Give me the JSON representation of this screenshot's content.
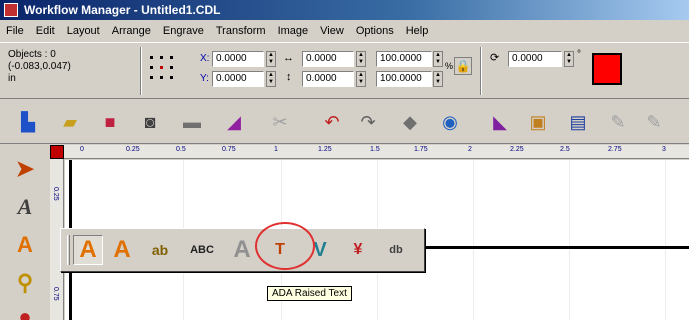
{
  "window": {
    "title": "Workflow Manager - Untitled1.CDL"
  },
  "menu": [
    "File",
    "Edit",
    "Layout",
    "Arrange",
    "Engrave",
    "Transform",
    "Image",
    "View",
    "Options",
    "Help"
  ],
  "properties": {
    "objects_label": "Objects : 0",
    "position_label": "(-0.083,0.047)",
    "units_label": "in",
    "x_label": "X:",
    "x_value": "0.0000",
    "y_label": "Y:",
    "y_value": "0.0000",
    "width_value": "0.0000",
    "height_value": "0.0000",
    "width_percent": "100.0000",
    "height_percent": "100.0000",
    "percent_symbol": "%",
    "rotation_value": "0.0000",
    "degree_symbol": "°",
    "fill_color": "#ff0000"
  },
  "toolbar_icons": [
    "new-file-icon",
    "open-folder-icon",
    "save-icon",
    "print-preview-icon",
    "print-icon",
    "engrave-icon",
    "cut-icon",
    "undo-icon",
    "redo-icon",
    "shape-icon",
    "zoom-icon",
    "import-icon",
    "image-icon",
    "view-icon",
    "magic-icon",
    "magic2-icon"
  ],
  "left_tools": [
    "select-icon",
    "text-icon",
    "text-tools-icon",
    "zoom-icon",
    "shape-tool-icon"
  ],
  "ruler": {
    "h_ticks": [
      "0",
      "0.25",
      "0.5",
      "0.75",
      "1",
      "1.25",
      "1.5",
      "1.75",
      "2",
      "2.25",
      "2.5",
      "2.75",
      "3"
    ],
    "v_ticks": [
      "0.25",
      "0.75"
    ]
  },
  "flyout": {
    "tools": [
      {
        "name": "artistic-text-tool",
        "glyph": "A"
      },
      {
        "name": "text-tool",
        "glyph": "A"
      },
      {
        "name": "paragraph-text-tool",
        "glyph": "ab"
      },
      {
        "name": "spell-check-tool",
        "glyph": "ABC"
      },
      {
        "name": "outline-text-tool",
        "glyph": "A"
      },
      {
        "name": "ada-raised-text-tool",
        "glyph": "T"
      },
      {
        "name": "v-carve-tool",
        "glyph": "V"
      },
      {
        "name": "text-transform-tool",
        "glyph": "¥"
      },
      {
        "name": "braille-tool",
        "glyph": "db"
      }
    ]
  },
  "tooltip": {
    "text": "ADA Raised Text"
  }
}
